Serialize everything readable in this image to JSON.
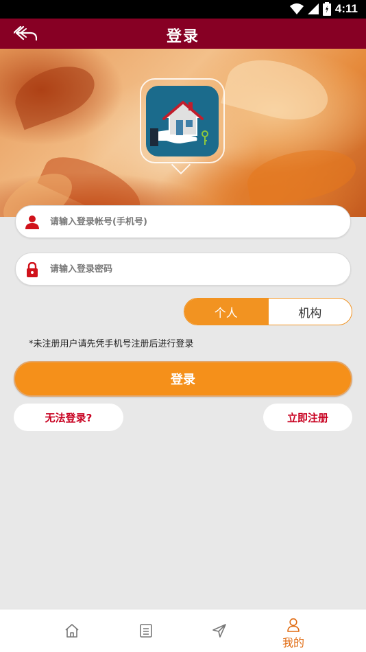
{
  "status_bar": {
    "time": "4:11"
  },
  "header": {
    "title": "登录",
    "back_icon": "back-arrow-icon"
  },
  "form": {
    "account_placeholder": "请输入登录帐号(手机号)",
    "password_placeholder": "请输入登录密码",
    "account_icon": "user-icon",
    "password_icon": "lock-icon"
  },
  "user_type": {
    "options": [
      "个人",
      "机构"
    ],
    "selected": "个人"
  },
  "notice": "*未注册用户请先凭手机号注册后进行登录",
  "actions": {
    "login_label": "登录",
    "cant_login_label": "无法登录?",
    "register_label": "立即注册"
  },
  "colors": {
    "header": "#870024",
    "accent": "#f29321",
    "link_red": "#c80020",
    "nav_active": "#e06a10"
  },
  "bottom_nav": {
    "items": [
      {
        "icon": "home-icon",
        "label": ""
      },
      {
        "icon": "list-icon",
        "label": ""
      },
      {
        "icon": "send-icon",
        "label": ""
      },
      {
        "icon": "user-icon",
        "label": "我的",
        "active": true
      }
    ]
  }
}
